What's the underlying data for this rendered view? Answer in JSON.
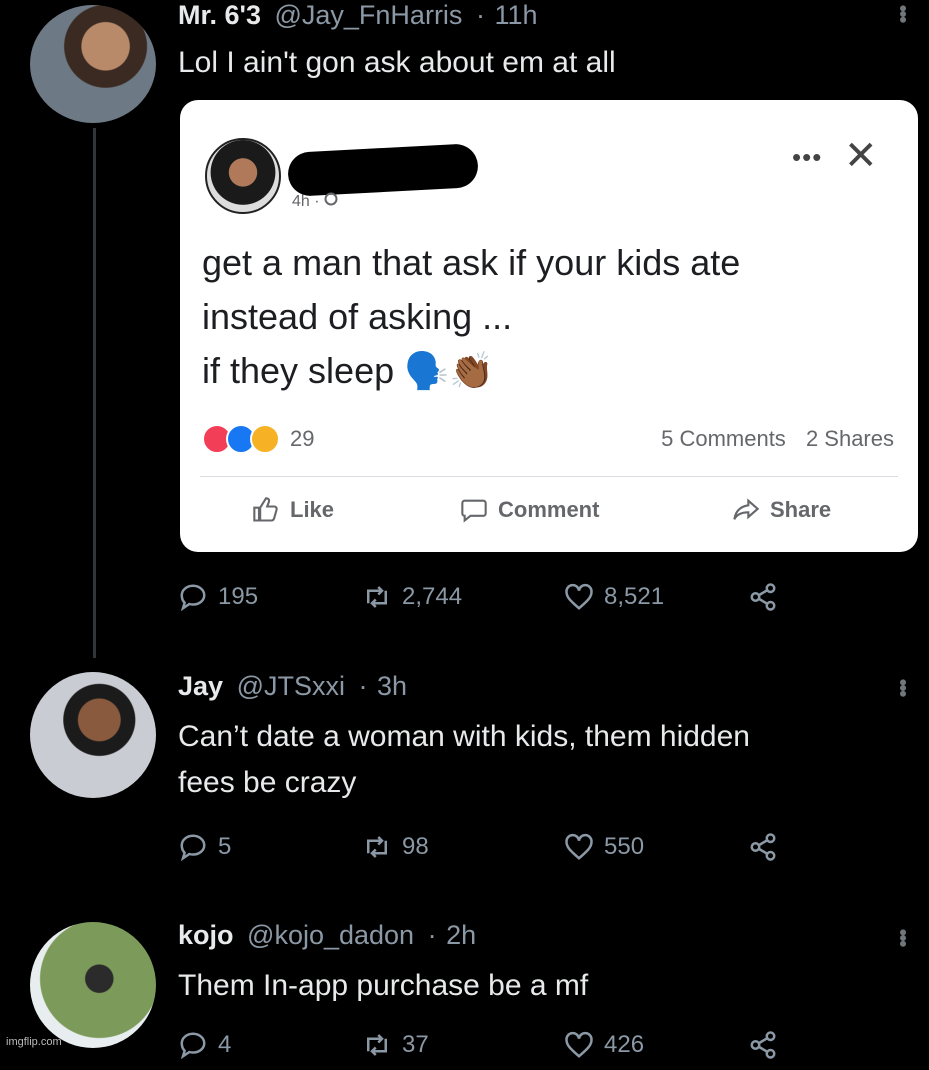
{
  "tweet1": {
    "name": "Mr. 6'3",
    "handle": "@Jay_FnHarris",
    "time": "11h",
    "text": "Lol I ain't gon ask about em at all",
    "embed": {
      "time": "4h · ",
      "lines": [
        "get a man that ask if your kids ate",
        "instead of asking ...",
        "if they sleep 🗣️👏🏾"
      ],
      "reaction_count": "29",
      "comments": "5 Comments",
      "shares": "2 Shares",
      "like_label": "Like",
      "comment_label": "Comment",
      "share_label": "Share"
    },
    "replies": "195",
    "retweets": "2,744",
    "likes": "8,521"
  },
  "tweet2": {
    "name": "Jay",
    "handle": "@JTSxxi",
    "time": "3h",
    "text_line1": "Can’t date a woman with kids, them hidden",
    "text_line2": "fees be crazy",
    "replies": "5",
    "retweets": "98",
    "likes": "550"
  },
  "tweet3": {
    "name": "kojo",
    "handle": "@kojo_dadon",
    "time": "2h",
    "text": "Them In-app purchase be a mf",
    "replies": "4",
    "retweets": "37",
    "likes": "426"
  },
  "watermark": "imgflip.com",
  "icons": {
    "reply": "reply-icon",
    "retweet": "retweet-icon",
    "like": "heart-icon",
    "share": "share-icon",
    "more": "more-icon"
  },
  "colors": {
    "background": "#000000",
    "muted": "#8b98a5",
    "fb_blue": "#1877f2"
  }
}
